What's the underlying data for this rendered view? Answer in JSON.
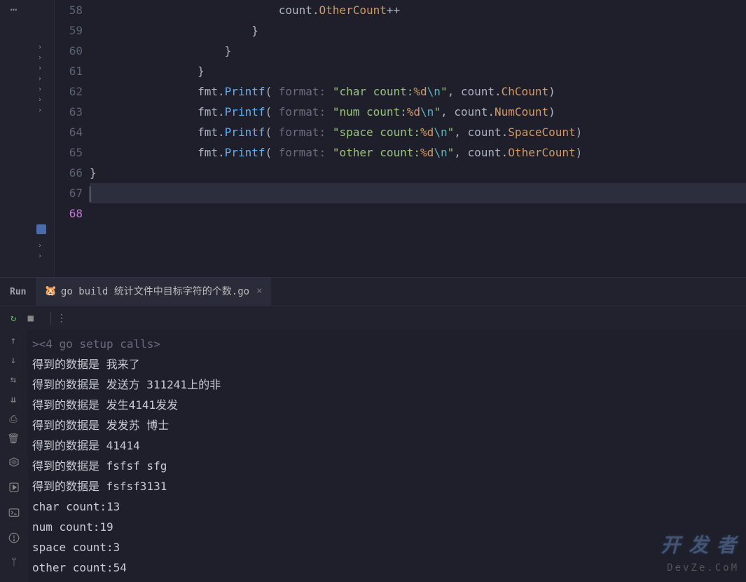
{
  "editor": {
    "lines": [
      {
        "num": "58",
        "indent": 7,
        "tokens": [
          {
            "t": "count",
            "c": "c-ident"
          },
          {
            "t": ".",
            "c": "c-op"
          },
          {
            "t": "OtherCount",
            "c": "c-prop"
          },
          {
            "t": "++",
            "c": "c-op"
          }
        ]
      },
      {
        "num": "59",
        "indent": 6,
        "tokens": [
          {
            "t": "}",
            "c": "c-brace"
          }
        ]
      },
      {
        "num": "60",
        "indent": 5,
        "tokens": [
          {
            "t": "}",
            "c": "c-brace"
          }
        ]
      },
      {
        "num": "61",
        "indent": 4,
        "tokens": [
          {
            "t": "}",
            "c": "c-brace"
          }
        ]
      },
      {
        "num": "62",
        "indent": 0,
        "tokens": []
      },
      {
        "num": "63",
        "indent": 4,
        "tokens": [
          {
            "t": "fmt",
            "c": "c-ident"
          },
          {
            "t": ".",
            "c": "c-op"
          },
          {
            "t": "Printf",
            "c": "c-method"
          },
          {
            "t": "(",
            "c": "c-op"
          },
          {
            "t": " format: ",
            "c": "c-hint"
          },
          {
            "t": "\"char count:",
            "c": "c-str"
          },
          {
            "t": "%d",
            "c": "c-fmt"
          },
          {
            "t": "\\n",
            "c": "c-esc"
          },
          {
            "t": "\"",
            "c": "c-str"
          },
          {
            "t": ", ",
            "c": "c-op"
          },
          {
            "t": "count",
            "c": "c-ident"
          },
          {
            "t": ".",
            "c": "c-op"
          },
          {
            "t": "ChCount",
            "c": "c-prop"
          },
          {
            "t": ")",
            "c": "c-op"
          }
        ]
      },
      {
        "num": "64",
        "indent": 4,
        "tokens": [
          {
            "t": "fmt",
            "c": "c-ident"
          },
          {
            "t": ".",
            "c": "c-op"
          },
          {
            "t": "Printf",
            "c": "c-method"
          },
          {
            "t": "(",
            "c": "c-op"
          },
          {
            "t": " format: ",
            "c": "c-hint"
          },
          {
            "t": "\"num count:",
            "c": "c-str"
          },
          {
            "t": "%d",
            "c": "c-fmt"
          },
          {
            "t": "\\n",
            "c": "c-esc"
          },
          {
            "t": "\"",
            "c": "c-str"
          },
          {
            "t": ", ",
            "c": "c-op"
          },
          {
            "t": "count",
            "c": "c-ident"
          },
          {
            "t": ".",
            "c": "c-op"
          },
          {
            "t": "NumCount",
            "c": "c-prop"
          },
          {
            "t": ")",
            "c": "c-op"
          }
        ]
      },
      {
        "num": "65",
        "indent": 4,
        "tokens": [
          {
            "t": "fmt",
            "c": "c-ident"
          },
          {
            "t": ".",
            "c": "c-op"
          },
          {
            "t": "Printf",
            "c": "c-method"
          },
          {
            "t": "(",
            "c": "c-op"
          },
          {
            "t": " format: ",
            "c": "c-hint"
          },
          {
            "t": "\"space count:",
            "c": "c-str"
          },
          {
            "t": "%d",
            "c": "c-fmt"
          },
          {
            "t": "\\n",
            "c": "c-esc"
          },
          {
            "t": "\"",
            "c": "c-str"
          },
          {
            "t": ", ",
            "c": "c-op"
          },
          {
            "t": "count",
            "c": "c-ident"
          },
          {
            "t": ".",
            "c": "c-op"
          },
          {
            "t": "SpaceCount",
            "c": "c-prop"
          },
          {
            "t": ")",
            "c": "c-op"
          }
        ]
      },
      {
        "num": "66",
        "indent": 4,
        "tokens": [
          {
            "t": "fmt",
            "c": "c-ident"
          },
          {
            "t": ".",
            "c": "c-op"
          },
          {
            "t": "Printf",
            "c": "c-method"
          },
          {
            "t": "(",
            "c": "c-op"
          },
          {
            "t": " format: ",
            "c": "c-hint"
          },
          {
            "t": "\"other count:",
            "c": "c-str"
          },
          {
            "t": "%d",
            "c": "c-fmt"
          },
          {
            "t": "\\n",
            "c": "c-esc"
          },
          {
            "t": "\"",
            "c": "c-str"
          },
          {
            "t": ", ",
            "c": "c-op"
          },
          {
            "t": "count",
            "c": "c-ident"
          },
          {
            "t": ".",
            "c": "c-op"
          },
          {
            "t": "OtherCount",
            "c": "c-prop"
          },
          {
            "t": ")",
            "c": "c-op"
          }
        ]
      },
      {
        "num": "67",
        "indent": 0,
        "tokens": [
          {
            "t": "}",
            "c": "c-brace"
          }
        ]
      },
      {
        "num": "68",
        "indent": 0,
        "tokens": [],
        "current": true
      }
    ]
  },
  "run": {
    "label": "Run",
    "tab": {
      "icon": "🐹",
      "title": "go build 统计文件中目标字符的个数.go",
      "close": "×"
    }
  },
  "console": {
    "lines": [
      "><4 go setup calls>",
      "得到的数据是 我来了",
      "得到的数据是 发送方 311241上的非",
      "得到的数据是 发生4141发发",
      "得到的数据是 发发苏 博士",
      "得到的数据是 41414",
      "得到的数据是 fsfsf sfg",
      "得到的数据是 fsfsf3131",
      "char count:13",
      "num count:19",
      "space count:3",
      "other count:54"
    ]
  },
  "watermark": {
    "w1": "开 发 者",
    "w2": "DevZe.CoM"
  }
}
